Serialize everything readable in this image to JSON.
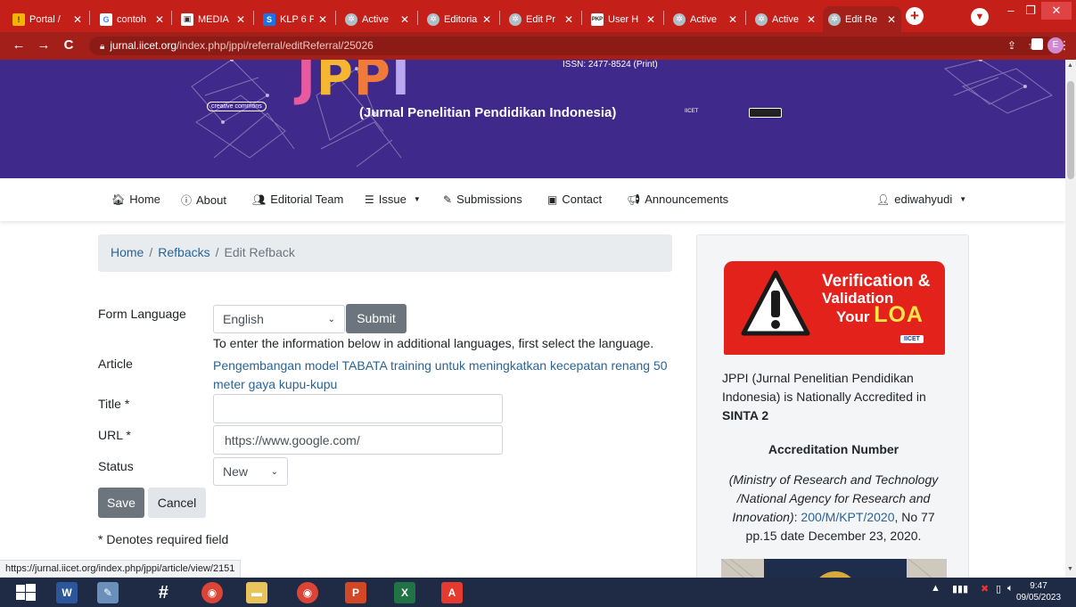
{
  "browser": {
    "tabs": [
      {
        "title": "Portal /",
        "favicon_color": "#f4b400"
      },
      {
        "title": "contoh",
        "favicon_color": "#ffffff"
      },
      {
        "title": "MEDIA",
        "favicon_color": "#ffffff"
      },
      {
        "title": "KLP 6 P",
        "favicon_color": "#1a73e8"
      },
      {
        "title": "Active",
        "favicon_color": "#b0bec5"
      },
      {
        "title": "Editoria",
        "favicon_color": "#b0bec5"
      },
      {
        "title": "Edit Pr",
        "favicon_color": "#b0bec5"
      },
      {
        "title": "User H",
        "favicon_color": "#ffffff"
      },
      {
        "title": "Active",
        "favicon_color": "#b0bec5"
      },
      {
        "title": "Active",
        "favicon_color": "#b0bec5"
      },
      {
        "title": "Edit Re",
        "favicon_color": "#b0bec5",
        "active": true
      }
    ],
    "url_domain": "jurnal.iicet.org",
    "url_path": "/index.php/jppi/referral/editReferral/25026",
    "profile_initial": "E",
    "status_url": "https://jurnal.iicet.org/index.php/jppi/article/view/2151"
  },
  "banner": {
    "logo_letters": [
      "J",
      "P",
      "P",
      "I"
    ],
    "logo_colors": [
      "#e85aa0",
      "#f5b632",
      "#f07a3a",
      "#b9a7f0"
    ],
    "issn": "ISSN: 2477-8524  (Print)",
    "journal_name": "(Jurnal Penelitian Pendidikan Indonesia)",
    "cc_text": "creative commons",
    "iicet_text": "IICET"
  },
  "nav": {
    "home": "Home",
    "about": "About",
    "editorial_team": "Editorial Team",
    "issue": "Issue",
    "submissions": "Submissions",
    "contact": "Contact",
    "announcements": "Announcements",
    "user": "ediwahyudi"
  },
  "breadcrumb": {
    "home": "Home",
    "refbacks": "Refbacks",
    "current": "Edit Refback"
  },
  "form": {
    "form_language_label": "Form Language",
    "language_value": "English",
    "submit_label": "Submit",
    "language_help": "To enter the information below in additional languages, first select the language.",
    "article_label": "Article",
    "article_title": "Pengembangan model TABATA training untuk meningkatkan kecepatan renang 50 meter gaya kupu-kupu",
    "title_label": "Title *",
    "title_value": "",
    "url_label": "URL *",
    "url_value": "https://www.google.com/",
    "status_label": "Status",
    "status_value": "New",
    "save_label": "Save",
    "cancel_label": "Cancel",
    "required_note": "* Denotes required field"
  },
  "sidebar": {
    "loa_line1": "Verification &",
    "loa_line2": "Validation",
    "loa_line3_pre": "Your",
    "loa_line3_big": "LOA",
    "loa_badge": "IICET",
    "accr_text": "JPPI (Jurnal Penelitian Pendidikan Indonesia) is Nationally Accredited in",
    "accr_rank": "SINTA 2",
    "accr_number_heading": "Accreditation Number",
    "ministry_text": "(Ministry of Research and Technology /National Agency for Research and Innovation)",
    "decree_link": "200/M/KPT/2020",
    "decree_rest": ", No 77 pp.15 date December 23, 2020."
  },
  "taskbar": {
    "time": "9:47",
    "date": "09/05/2023"
  }
}
